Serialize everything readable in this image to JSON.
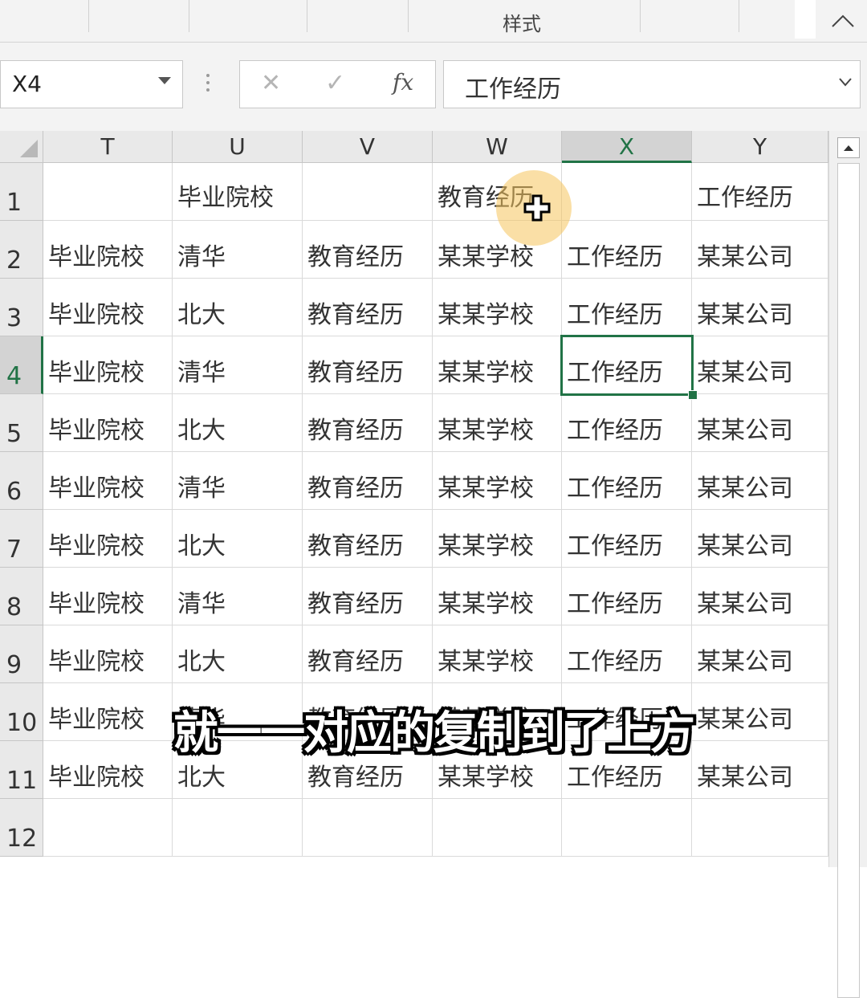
{
  "ribbon": {
    "group_label": "样式"
  },
  "formula_bar": {
    "name_box": "X4",
    "cancel_symbol": "✕",
    "enter_symbol": "✓",
    "fx_label": "fx",
    "content": "工作经历"
  },
  "grid": {
    "columns": [
      "T",
      "U",
      "V",
      "W",
      "X",
      "Y"
    ],
    "active_column": "X",
    "rows": [
      "1",
      "2",
      "3",
      "4",
      "5",
      "6",
      "7",
      "8",
      "9",
      "10",
      "11",
      "12"
    ],
    "active_row": "4",
    "cells": [
      [
        "",
        "毕业院校",
        "",
        "教育经历",
        "",
        "工作经历"
      ],
      [
        "毕业院校",
        "清华",
        "教育经历",
        "某某学校",
        "工作经历",
        "某某公司"
      ],
      [
        "毕业院校",
        "北大",
        "教育经历",
        "某某学校",
        "工作经历",
        "某某公司"
      ],
      [
        "毕业院校",
        "清华",
        "教育经历",
        "某某学校",
        "工作经历",
        "某某公司"
      ],
      [
        "毕业院校",
        "北大",
        "教育经历",
        "某某学校",
        "工作经历",
        "某某公司"
      ],
      [
        "毕业院校",
        "清华",
        "教育经历",
        "某某学校",
        "工作经历",
        "某某公司"
      ],
      [
        "毕业院校",
        "北大",
        "教育经历",
        "某某学校",
        "工作经历",
        "某某公司"
      ],
      [
        "毕业院校",
        "清华",
        "教育经历",
        "某某学校",
        "工作经历",
        "某某公司"
      ],
      [
        "毕业院校",
        "北大",
        "教育经历",
        "某某学校",
        "工作经历",
        "某某公司"
      ],
      [
        "毕业院校",
        "清华",
        "教育经历",
        "某某学校",
        "工作经历",
        "某某公司"
      ],
      [
        "毕业院校",
        "北大",
        "教育经历",
        "某某学校",
        "工作经历",
        "某某公司"
      ],
      [
        "",
        "",
        "",
        "",
        "",
        ""
      ]
    ],
    "selected_cell": "X4"
  },
  "subtitle": "就一一对应的复制到了上方",
  "colors": {
    "accent": "#217346",
    "cursor_highlight": "#f6c45c"
  }
}
